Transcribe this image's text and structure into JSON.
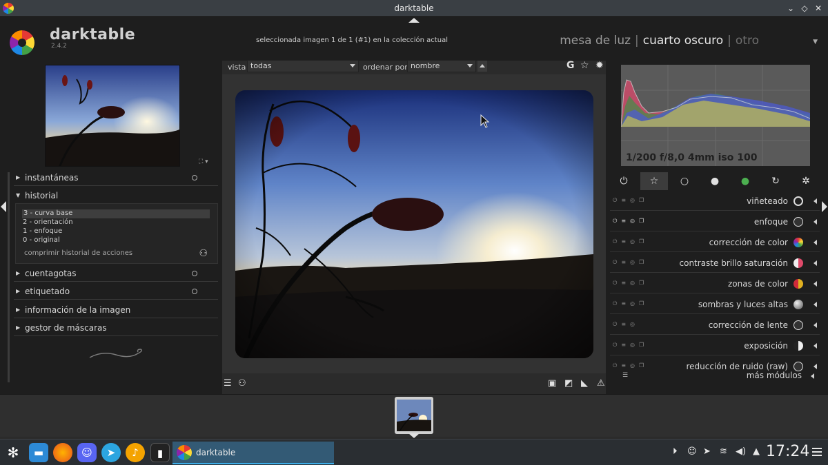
{
  "window": {
    "title": "darktable",
    "minimize_glyph": "⌄",
    "maximize_glyph": "◇",
    "close_glyph": "✕"
  },
  "header": {
    "app_name": "darktable",
    "version": "2.4.2",
    "collection_info": "seleccionada imagen 1 de 1 (#1) en la colección actual",
    "views": {
      "lighttable": "mesa de luz",
      "darkroom": "cuarto oscuro",
      "other": "otro",
      "separator": "|"
    }
  },
  "left_panel": {
    "sections": {
      "snapshots": "instantáneas",
      "history": "historial",
      "colorpicker": "cuentagotas",
      "tagging": "etiquetado",
      "image_info": "información de la imagen",
      "mask_manager": "gestor de máscaras"
    },
    "history_items": [
      "3 - curva base",
      "2 - orientación",
      "1 - enfoque",
      "0 - original"
    ],
    "history_selected_index": 0,
    "compress_label": "comprimir historial de acciones"
  },
  "filter_bar": {
    "view_label": "vista",
    "view_value": "todas",
    "sort_label": "ordenar por",
    "sort_value": "nombre",
    "icon_grouping": "G",
    "icon_star": "☆",
    "icon_gear": "✹"
  },
  "right_panel": {
    "exif": "1/200 f/8,0 4mm iso 100",
    "groups": [
      "power-icon",
      "favorites-icon",
      "base-icon",
      "tone-icon",
      "color-icon",
      "correct-icon",
      "effect-icon"
    ],
    "modules": [
      {
        "name": "viñeteado",
        "icon_color": "#222",
        "enabled": false
      },
      {
        "name": "enfoque",
        "icon_color": "#333",
        "enabled": true
      },
      {
        "name": "corrección de color",
        "icon_color": "#3c8fd8",
        "enabled": false
      },
      {
        "name": "contraste brillo saturación",
        "icon_color": "#e04a6a",
        "enabled": false
      },
      {
        "name": "zonas de color",
        "icon_color": "#e0b020",
        "enabled": false
      },
      {
        "name": "sombras y luces altas",
        "icon_color": "#888",
        "enabled": false
      },
      {
        "name": "corrección de lente",
        "icon_color": "#444",
        "enabled": false
      },
      {
        "name": "exposición",
        "icon_color": "#ddd",
        "enabled": false
      },
      {
        "name": "reducción de ruido (raw)",
        "icon_color": "#444",
        "enabled": false
      }
    ],
    "more_modules": "más módulos"
  },
  "taskbar": {
    "task_label": "darktable",
    "clock": "17:24"
  }
}
